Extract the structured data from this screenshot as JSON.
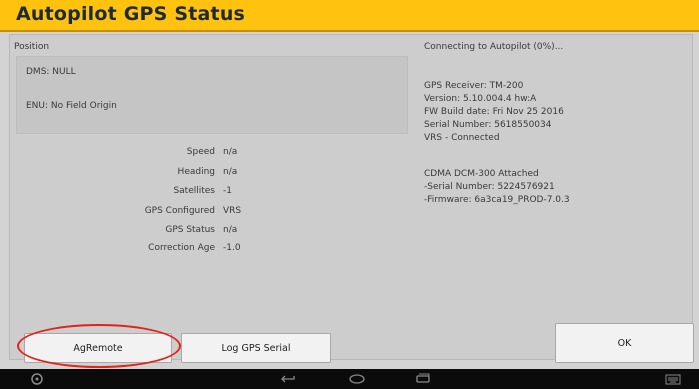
{
  "window": {
    "title": "Autopilot GPS Status"
  },
  "position": {
    "label": "Position",
    "dms": "DMS: NULL",
    "enu": "ENU: No Field Origin"
  },
  "stats": [
    {
      "label": "Speed",
      "value": "n/a"
    },
    {
      "label": "Heading",
      "value": "n/a"
    },
    {
      "label": "Satellites",
      "value": "-1"
    },
    {
      "label": "GPS Configured",
      "value": "VRS"
    },
    {
      "label": "GPS Status",
      "value": "n/a"
    },
    {
      "label": "Correction Age",
      "value": "-1.0"
    }
  ],
  "receiver": {
    "connecting": "Connecting to Autopilot (0%)...",
    "receiver": "GPS Receiver: TM-200",
    "version": "Version: 5.10.004.4 hw:A",
    "fw_build": "FW Build date: Fri Nov 25 2016",
    "serial": "Serial Number: 5618550034",
    "vrs": "VRS - Connected",
    "cdma": "CDMA DCM-300 Attached",
    "cdma_serial": "-Serial Number: 5224576921",
    "cdma_firmware": "-Firmware: 6a3ca19_PROD-7.0.3"
  },
  "buttons": {
    "agremote": "AgRemote",
    "log_gps_serial": "Log GPS Serial",
    "ok": "OK"
  },
  "annotation": {
    "highlight_color": "#e2231a"
  },
  "nav_icons": [
    "power-icon",
    "back-icon",
    "home-icon",
    "recent-apps-icon",
    "keyboard-icon"
  ]
}
